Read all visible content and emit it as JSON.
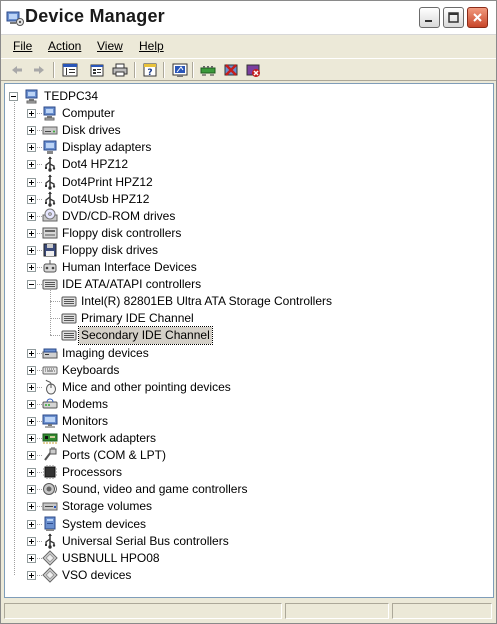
{
  "window": {
    "title": "Device Manager"
  },
  "menu": [
    {
      "label": "File"
    },
    {
      "label": "Action"
    },
    {
      "label": "View"
    },
    {
      "label": "Help"
    }
  ],
  "toolbar": [
    {
      "icon": "back-arrow-icon"
    },
    {
      "icon": "forward-arrow-icon"
    },
    {
      "icon": "show-hide-console-tree-icon"
    },
    {
      "icon": "properties-icon"
    },
    {
      "icon": "print-icon"
    },
    {
      "icon": "help-icon"
    },
    {
      "icon": "scan-hardware-changes-icon"
    },
    {
      "icon": "update-driver-icon"
    },
    {
      "icon": "disable-device-icon"
    },
    {
      "icon": "uninstall-device-icon"
    }
  ],
  "tree": {
    "root": {
      "label": "TEDPC34",
      "icon": "computer-icon"
    },
    "items": [
      {
        "label": "Computer",
        "icon": "computer-icon",
        "expanded": false
      },
      {
        "label": "Disk drives",
        "icon": "disk-drive-icon",
        "expanded": false
      },
      {
        "label": "Display adapters",
        "icon": "display-adapter-icon",
        "expanded": false
      },
      {
        "label": "Dot4 HPZ12",
        "icon": "usb-icon",
        "expanded": false
      },
      {
        "label": "Dot4Print HPZ12",
        "icon": "usb-icon",
        "expanded": false
      },
      {
        "label": "Dot4Usb HPZ12",
        "icon": "usb-icon",
        "expanded": false
      },
      {
        "label": "DVD/CD-ROM drives",
        "icon": "cd-drive-icon",
        "expanded": false
      },
      {
        "label": "Floppy disk controllers",
        "icon": "controller-icon",
        "expanded": false
      },
      {
        "label": "Floppy disk drives",
        "icon": "floppy-drive-icon",
        "expanded": false
      },
      {
        "label": "Human Interface Devices",
        "icon": "hid-icon",
        "expanded": false
      },
      {
        "label": "IDE ATA/ATAPI controllers",
        "icon": "ide-controller-icon",
        "expanded": true,
        "children": [
          {
            "label": "Intel(R) 82801EB Ultra ATA Storage Controllers",
            "icon": "ide-controller-icon",
            "selected": false
          },
          {
            "label": "Primary IDE Channel",
            "icon": "ide-controller-icon",
            "selected": false
          },
          {
            "label": "Secondary IDE Channel",
            "icon": "ide-controller-icon",
            "selected": true
          }
        ]
      },
      {
        "label": "Imaging devices",
        "icon": "scanner-icon",
        "expanded": false
      },
      {
        "label": "Keyboards",
        "icon": "keyboard-icon",
        "expanded": false
      },
      {
        "label": "Mice and other pointing devices",
        "icon": "mouse-icon",
        "expanded": false
      },
      {
        "label": "Modems",
        "icon": "modem-icon",
        "expanded": false
      },
      {
        "label": "Monitors",
        "icon": "monitor-icon",
        "expanded": false
      },
      {
        "label": "Network adapters",
        "icon": "network-adapter-icon",
        "expanded": false
      },
      {
        "label": "Ports (COM & LPT)",
        "icon": "port-icon",
        "expanded": false
      },
      {
        "label": "Processors",
        "icon": "processor-icon",
        "expanded": false
      },
      {
        "label": "Sound, video and game controllers",
        "icon": "sound-icon",
        "expanded": false
      },
      {
        "label": "Storage volumes",
        "icon": "storage-volume-icon",
        "expanded": false
      },
      {
        "label": "System devices",
        "icon": "system-device-icon",
        "expanded": false
      },
      {
        "label": "Universal Serial Bus controllers",
        "icon": "usb-icon",
        "expanded": false
      },
      {
        "label": "USBNULL HPO08",
        "icon": "generic-device-icon",
        "expanded": false
      },
      {
        "label": "VSO devices",
        "icon": "generic-device-icon",
        "expanded": false
      }
    ]
  },
  "colors": {
    "selection": "#d4d0c8",
    "tree_lines": "#a0a0a0",
    "window_bg": "#ece9d8"
  }
}
